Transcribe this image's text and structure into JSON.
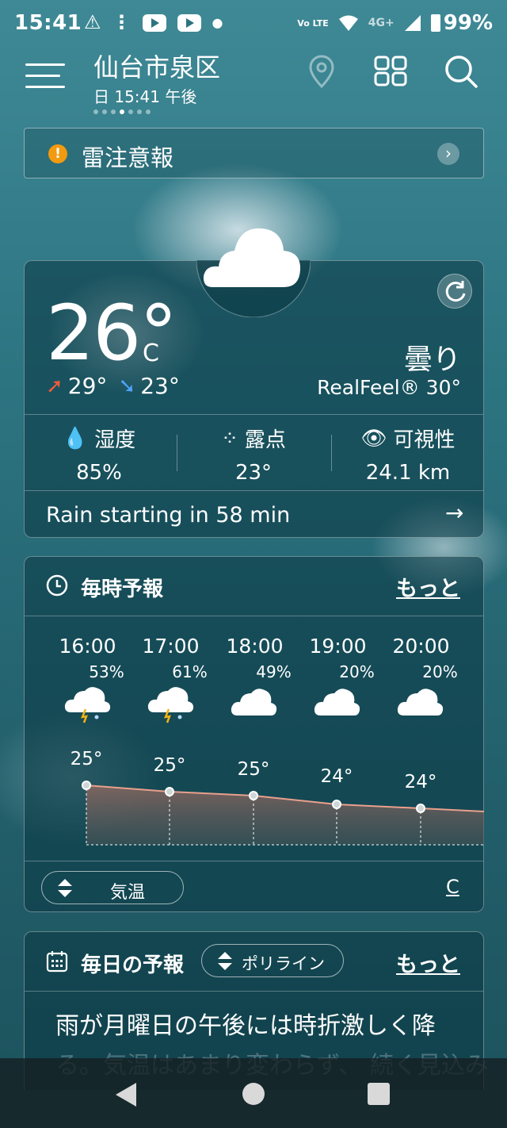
{
  "status_bar": {
    "time": "15:41",
    "signal_label": "Vo LTE",
    "network": "4G+",
    "battery": "99%"
  },
  "header": {
    "city": "仙台市泉区",
    "datetime": "日 15:41 午後"
  },
  "alert": {
    "text": "雷注意報"
  },
  "current": {
    "temp": "26°",
    "unit": "C",
    "high": "29°",
    "low": "23°",
    "condition": "曇り",
    "realfeel": "RealFeel® 30°",
    "humidity_label": "湿度",
    "humidity": "85%",
    "dewpoint_label": "露点",
    "dewpoint": "23°",
    "visibility_label": "可視性",
    "visibility": "24.1 km",
    "rain_msg": "Rain starting in 58 min"
  },
  "hourly": {
    "title": "毎時予報",
    "more": "もっと",
    "hours": [
      {
        "time": "16:00",
        "precip": "53%",
        "temp": "25°",
        "icon": "thunder-rain-cloud-icon"
      },
      {
        "time": "17:00",
        "precip": "61%",
        "temp": "25°",
        "icon": "thunder-rain-cloud-icon"
      },
      {
        "time": "18:00",
        "precip": "49%",
        "temp": "25°",
        "icon": "cloud-icon"
      },
      {
        "time": "19:00",
        "precip": "20%",
        "temp": "24°",
        "icon": "cloud-icon"
      },
      {
        "time": "20:00",
        "precip": "20%",
        "temp": "24°",
        "icon": "cloud-icon"
      }
    ],
    "selector": "気温",
    "unit": "C"
  },
  "daily": {
    "title": "毎日の予報",
    "selector": "ポリライン",
    "more": "もっと",
    "summary": "雨が月曜日の午後には時折激しく降",
    "summary_cont": "る。気温はあまり変わらず、 続く見込み"
  },
  "colors": {
    "accent_orange": "#f29a10",
    "temp_up": "#f05a3c",
    "temp_down": "#4fa3ff",
    "line": "#e9a08c"
  }
}
